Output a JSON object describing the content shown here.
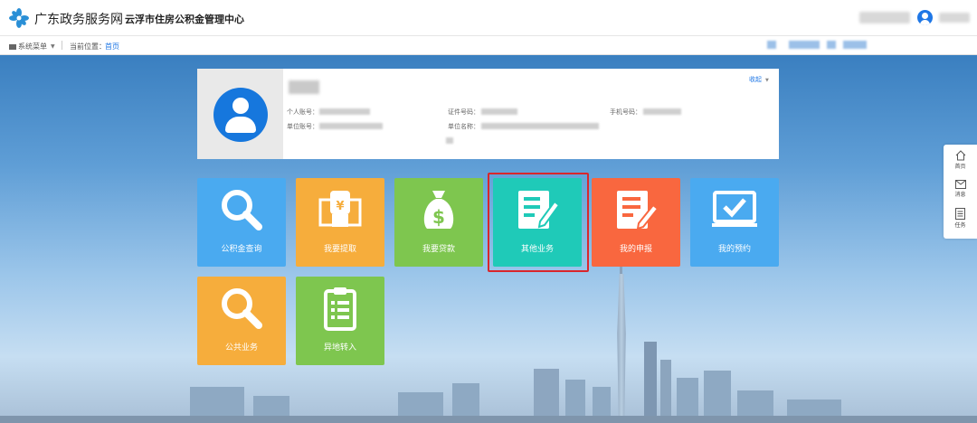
{
  "header": {
    "site_name": "广东政务服务网",
    "org_name": "云浮市住房公积金管理中心"
  },
  "subbar": {
    "menu_label": "系统菜单",
    "location_label": "当前位置：",
    "location_home": "首页"
  },
  "profile": {
    "collapse_label": "收起",
    "fields": {
      "personal_account": "个人账号：",
      "unit_account": "单位账号：",
      "id_number": "证件号码：",
      "unit_name": "单位名称：",
      "phone": "手机号码："
    }
  },
  "tiles": [
    {
      "label": "公积金查询",
      "color": "#4aaaf0",
      "icon": "magnifier-icon"
    },
    {
      "label": "我要提取",
      "color": "#f6ad3c",
      "icon": "money-hand-icon"
    },
    {
      "label": "我要贷款",
      "color": "#7ec64f",
      "icon": "money-bag-icon"
    },
    {
      "label": "其他业务",
      "color": "#1fcab8",
      "icon": "form-pen-icon"
    },
    {
      "label": "我的申报",
      "color": "#f9673f",
      "icon": "document-pen-icon"
    },
    {
      "label": "我的预约",
      "color": "#4aaaf0",
      "icon": "monitor-check-icon"
    },
    {
      "label": "公共业务",
      "color": "#f6ad3c",
      "icon": "magnifier-icon"
    },
    {
      "label": "异地转入",
      "color": "#7ec64f",
      "icon": "clipboard-icon"
    }
  ],
  "floatbar": {
    "home": "首页",
    "message": "消息",
    "task": "任务"
  }
}
